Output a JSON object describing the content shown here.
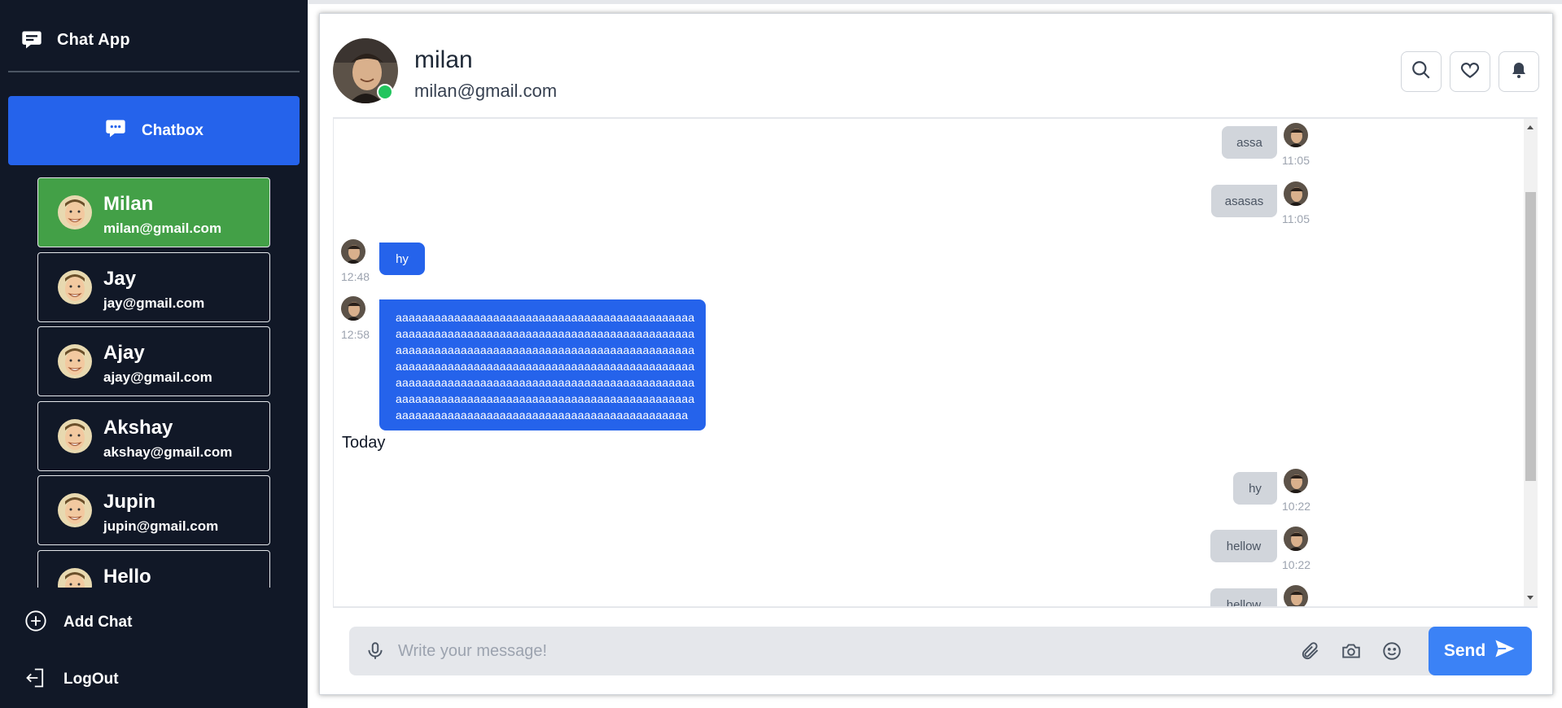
{
  "app": {
    "title": "Chat App"
  },
  "sidebar": {
    "chatbox_label": "Chatbox",
    "contacts": [
      {
        "name": "Milan",
        "email": "milan@gmail.com",
        "active": true
      },
      {
        "name": "Jay",
        "email": "jay@gmail.com",
        "active": false
      },
      {
        "name": "Ajay",
        "email": "ajay@gmail.com",
        "active": false
      },
      {
        "name": "Akshay",
        "email": "akshay@gmail.com",
        "active": false
      },
      {
        "name": "Jupin",
        "email": "jupin@gmail.com",
        "active": false
      },
      {
        "name": "Hello",
        "email": "",
        "active": false
      }
    ],
    "add_chat_label": "Add Chat",
    "logout_label": "LogOut"
  },
  "header": {
    "name": "milan",
    "email": "milan@gmail.com",
    "online": true,
    "actions": [
      "search-icon",
      "heart-icon",
      "bell-icon"
    ]
  },
  "messages": [
    {
      "direction": "out",
      "text": "assa",
      "time": "11:05"
    },
    {
      "direction": "out",
      "text": "asasas",
      "time": "11:05"
    },
    {
      "direction": "in",
      "text": "hy",
      "time": "12:48"
    },
    {
      "direction": "in",
      "lines": [
        "aaaaaaaaaaaaaaaaaaaaaaaaaaaaaaaaaaaaaaaaaaaaaa",
        "aaaaaaaaaaaaaaaaaaaaaaaaaaaaaaaaaaaaaaaaaaaaaa",
        "aaaaaaaaaaaaaaaaaaaaaaaaaaaaaaaaaaaaaaaaaaaaaa",
        "aaaaaaaaaaaaaaaaaaaaaaaaaaaaaaaaaaaaaaaaaaaaaa",
        "aaaaaaaaaaaaaaaaaaaaaaaaaaaaaaaaaaaaaaaaaaaaaa",
        "aaaaaaaaaaaaaaaaaaaaaaaaaaaaaaaaaaaaaaaaaaaaaa",
        "aaaaaaaaaaaaaaaaaaaaaaaaaaaaaaaaaaaaaaaaaaaaa"
      ],
      "time": "12:58"
    },
    {
      "direction": "separator",
      "text": "Today"
    },
    {
      "direction": "out",
      "text": "hy",
      "time": "10:22"
    },
    {
      "direction": "out",
      "text": "hellow",
      "time": "10:22"
    },
    {
      "direction": "out",
      "text": "hellow",
      "time": ""
    }
  ],
  "composer": {
    "placeholder": "Write your message!",
    "value": "",
    "send_label": "Send"
  },
  "colors": {
    "sidebar_bg": "#111827",
    "accent_blue": "#2563eb",
    "active_contact": "#43a047",
    "online": "#22c55e",
    "send_button": "#3b82f6"
  }
}
